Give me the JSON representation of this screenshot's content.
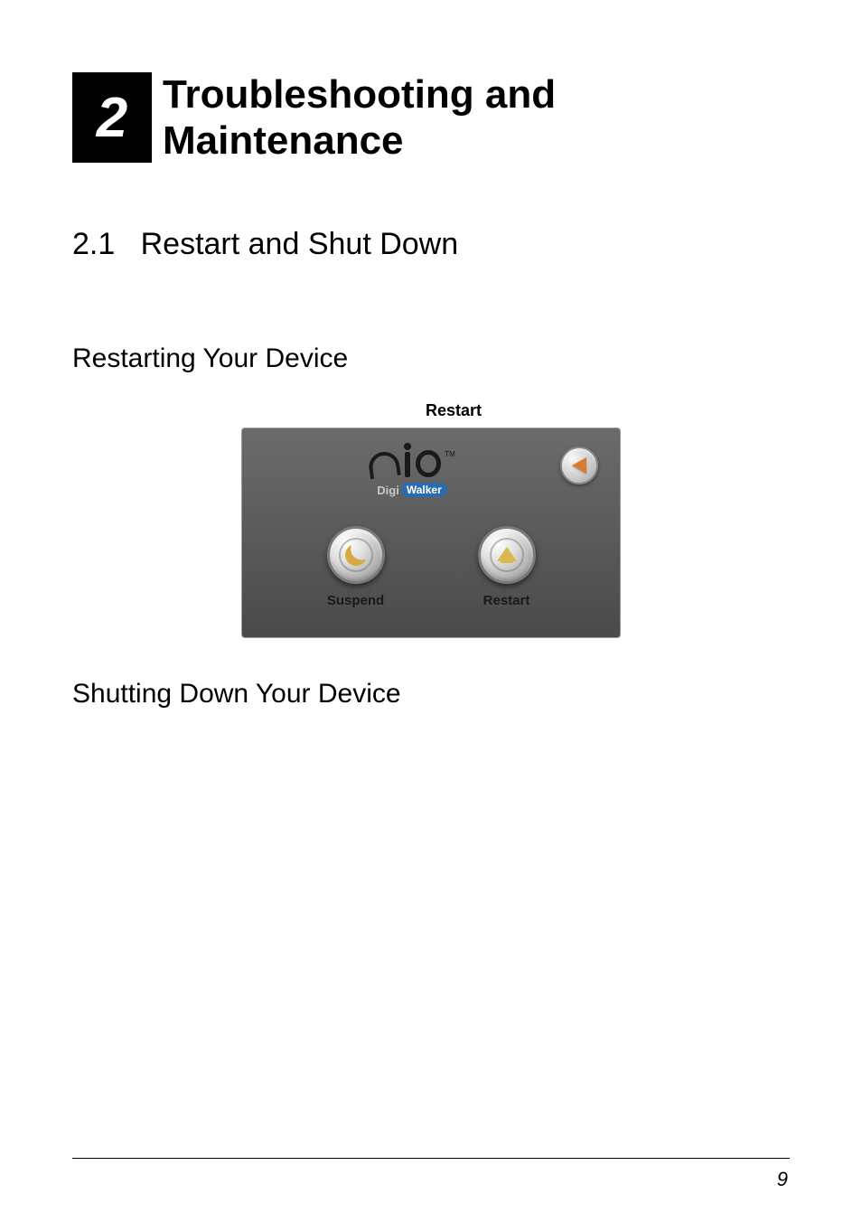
{
  "chapter": {
    "number": "2",
    "title": "Troubleshooting and Maintenance"
  },
  "section": {
    "number": "2.1",
    "title": "Restart and Shut Down"
  },
  "subsection1": "Restarting Your Device",
  "restart_label": "Restart",
  "device": {
    "logo_digi": "Digi",
    "logo_walker": "Walker",
    "logo_tm": "TM",
    "suspend_label": "Suspend",
    "restart_label": "Restart"
  },
  "subsection2": "Shutting Down Your Device",
  "page_number": "9"
}
